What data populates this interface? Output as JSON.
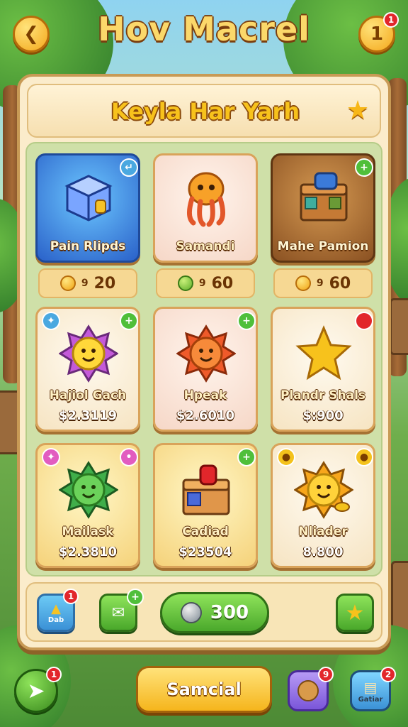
{
  "header": {
    "title": "Hov Macrel",
    "back_icon": "back-arrow-icon",
    "notification_count": "1",
    "notification_value": "1"
  },
  "panel": {
    "title": "Keyla Har Yarh",
    "star_icon": "star-icon"
  },
  "top_row": [
    {
      "name": "Pain Rlipds",
      "price": "20",
      "coin": "gold",
      "style": "blue"
    },
    {
      "name": "Samandi",
      "price": "60",
      "coin": "green",
      "style": "pink"
    },
    {
      "name": "Mahe Pamion",
      "price": "60",
      "coin": "gold",
      "style": "brown"
    }
  ],
  "price_prefix": "9",
  "cards": [
    {
      "name": "Hajiol Gach",
      "price": "$2.3119",
      "style": "cream"
    },
    {
      "name": "Hpeak",
      "price": "$2.6010",
      "style": "pink"
    },
    {
      "name": "Plandr Shals",
      "price": "$:900",
      "style": "cream"
    },
    {
      "name": "Mailask",
      "price": "$2.3810",
      "style": "yellow"
    },
    {
      "name": "Cadiad",
      "price": "$23504",
      "style": "yellow"
    },
    {
      "name": "Nliader",
      "price": "8.800",
      "style": "cream"
    }
  ],
  "bottom_bar": {
    "shop_label": "Dab",
    "shop_badge": "1",
    "currency_value": "300"
  },
  "footer": {
    "main_button_label": "Samcial",
    "left_badge": "1",
    "cookie_badge": "9",
    "right_badge": "2",
    "right_label": "Gatiar"
  },
  "colors": {
    "accent_gold": "#f5b51c",
    "accent_green": "#4aa82b",
    "badge_red": "#e2262b",
    "panel_bg": "#fbeccb"
  }
}
